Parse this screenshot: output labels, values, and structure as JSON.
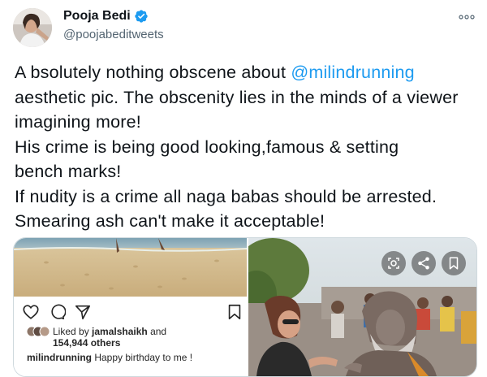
{
  "tweet": {
    "author_name": "Pooja Bedi",
    "handle": "@poojabeditweets",
    "text_lines": [
      {
        "before": "A bsolutely nothing obscene about ",
        "mention": "@milindrunning",
        "after": ""
      },
      {
        "before": "aesthetic pic. The obscenity lies in the minds of a viewer"
      },
      {
        "before": "imagining more!"
      },
      {
        "before": "His crime is being good looking,famous & setting"
      },
      {
        "before": "bench marks!"
      },
      {
        "before": "If nudity is a crime all naga babas should be arrested."
      },
      {
        "before": "Smearing ash can't make it acceptable!"
      }
    ]
  },
  "embedded_post": {
    "liked_by_prefix": "Liked by ",
    "liked_by_user": "jamalshaikh",
    "liked_and": " and",
    "liked_others": "154,944 others",
    "caption_user": "milindrunning",
    "caption_text": " Happy birthday to me !"
  },
  "colors": {
    "accent": "#1d9bf0",
    "text": "#0f1419",
    "secondary": "#536471"
  },
  "icons": [
    "verified-badge-icon",
    "more-options-icon",
    "heart-icon",
    "comment-icon",
    "share-icon",
    "bookmark-icon",
    "lens-icon",
    "photo-share-icon",
    "photo-bookmark-icon"
  ]
}
